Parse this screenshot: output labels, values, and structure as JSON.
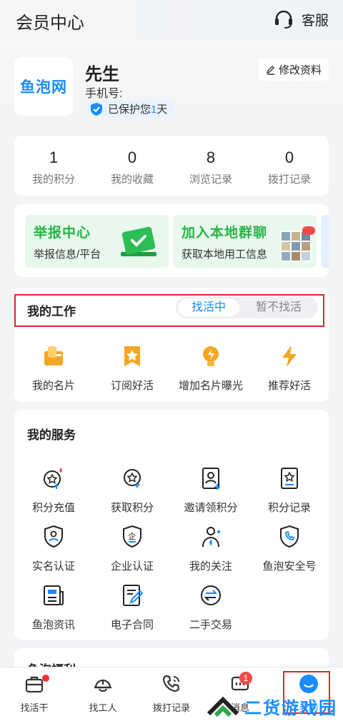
{
  "header": {
    "title": "会员中心",
    "service_label": "客服"
  },
  "profile": {
    "logo_text": "鱼泡网",
    "name": "先生",
    "phone_label": "手机号:",
    "protect_prefix": "已保护您",
    "protect_days": "1",
    "protect_suffix": "天",
    "edit_label": "修改资料"
  },
  "stats": [
    {
      "value": "1",
      "label": "我的积分"
    },
    {
      "value": "0",
      "label": "我的收藏"
    },
    {
      "value": "8",
      "label": "浏览记录"
    },
    {
      "value": "0",
      "label": "拨打记录"
    }
  ],
  "banners": [
    {
      "title": "举报中心",
      "subtitle": "举报信息/平台"
    },
    {
      "title": "加入本地群聊",
      "subtitle": "获取本地用工信息"
    }
  ],
  "work": {
    "title": "我的工作",
    "toggle_on": "找活中",
    "toggle_off": "暂不找活",
    "items": [
      {
        "label": "我的名片",
        "icon": "card-icon"
      },
      {
        "label": "订阅好活",
        "icon": "star-bookmark-icon"
      },
      {
        "label": "增加名片曝光",
        "icon": "lightbulb-icon"
      },
      {
        "label": "推荐好活",
        "icon": "lightning-icon"
      }
    ]
  },
  "services": {
    "title": "我的服务",
    "items": [
      {
        "label": "积分充值",
        "icon": "points-recharge-icon"
      },
      {
        "label": "获取积分",
        "icon": "get-points-icon"
      },
      {
        "label": "邀请领积分",
        "icon": "invite-icon"
      },
      {
        "label": "积分记录",
        "icon": "points-record-icon"
      },
      {
        "label": "实名认证",
        "icon": "id-shield-icon"
      },
      {
        "label": "企业认证",
        "icon": "enterprise-shield-icon"
      },
      {
        "label": "我的关注",
        "icon": "follow-icon"
      },
      {
        "label": "鱼泡安全号",
        "icon": "phone-shield-icon"
      },
      {
        "label": "鱼泡资讯",
        "icon": "news-icon"
      },
      {
        "label": "电子合同",
        "icon": "contract-icon"
      },
      {
        "label": "二手交易",
        "icon": "exchange-icon"
      }
    ]
  },
  "partial_section": {
    "title": "鱼泡福利"
  },
  "tabbar": {
    "items": [
      {
        "label": "找活干"
      },
      {
        "label": "找工人"
      },
      {
        "label": "拨打记录"
      },
      {
        "label": "消息",
        "badge": "1"
      },
      {
        "label": "我的"
      }
    ]
  },
  "watermark": {
    "text": "二货游戏园"
  },
  "colors": {
    "accent": "#1a8cff",
    "green": "#27b34a",
    "highlight": "#e0262d"
  }
}
